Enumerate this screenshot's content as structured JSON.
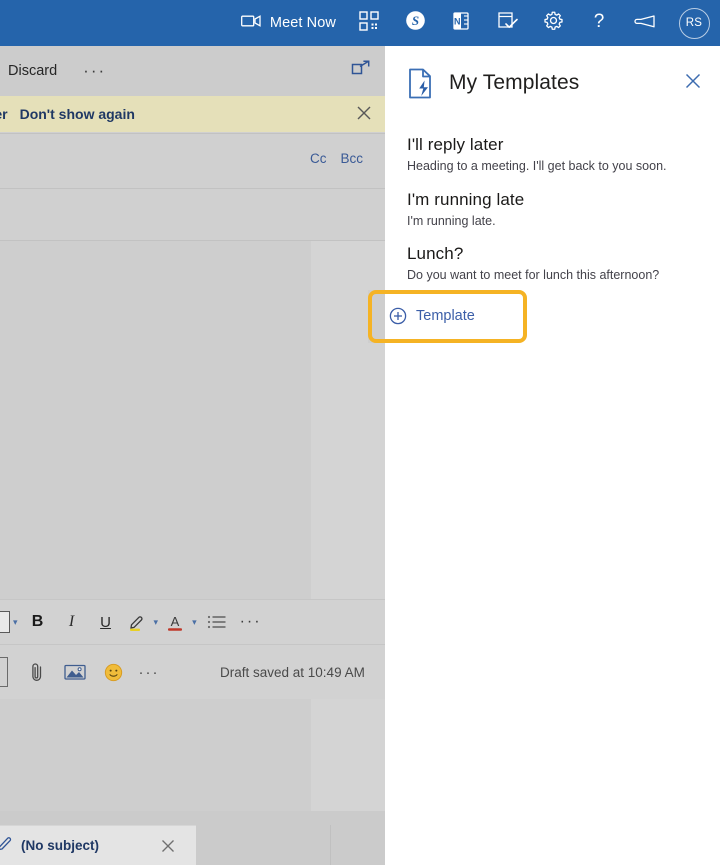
{
  "suitebar": {
    "background": "#2564ab",
    "meet_now_label": "Meet Now",
    "items": [
      {
        "name": "meet-now",
        "label": "Meet Now",
        "icon": "video-camera-icon"
      },
      {
        "name": "qr-code",
        "label": "",
        "icon": "qr-code-icon"
      },
      {
        "name": "skype",
        "label": "",
        "icon": "skype-icon"
      },
      {
        "name": "onenote",
        "label": "",
        "icon": "onenote-icon"
      },
      {
        "name": "to-do",
        "label": "",
        "icon": "checklist-icon"
      },
      {
        "name": "settings",
        "label": "",
        "icon": "gear-icon"
      },
      {
        "name": "help",
        "label": "",
        "icon": "question-mark-icon"
      },
      {
        "name": "feedback",
        "label": "",
        "icon": "megaphone-icon"
      },
      {
        "name": "account",
        "label": "RS",
        "icon": "avatar-icon"
      }
    ],
    "avatar_initials": "RS"
  },
  "compose": {
    "command_bar": {
      "discard_label": "Discard",
      "more_label": "···",
      "popout_icon": "pop-out-icon"
    },
    "notice": {
      "background": "#e5e0b9",
      "link_later": "later",
      "link_dont_show": "Don't show again",
      "close_icon": "close-icon"
    },
    "recipients": {
      "cc_label": "Cc",
      "bcc_label": "Bcc"
    },
    "format_toolbar": {
      "font_label": "",
      "bold_label": "B",
      "italic_label": "I",
      "underline_label": "U",
      "highlight_icon": "highlighter-icon",
      "font_color_icon": "font-color-icon",
      "bullets_icon": "bulleted-list-icon",
      "more_label": "···"
    },
    "attach_toolbar": {
      "attach_icon": "paperclip-icon",
      "image_icon": "picture-icon",
      "emoji_icon": "emoji-icon",
      "more_label": "···",
      "draft_status": "Draft saved at 10:49 AM"
    }
  },
  "tabstrip": {
    "draft_tab": {
      "label": "(No subject)",
      "pencil_icon": "pencil-icon",
      "close_icon": "close-icon"
    }
  },
  "panel": {
    "title": "My Templates",
    "logo_icon": "templates-document-bolt-icon",
    "close_icon": "close-icon",
    "templates": [
      {
        "title": "I'll reply later",
        "body": "Heading to a meeting. I'll get back to you soon."
      },
      {
        "title": "I'm running late",
        "body": "I'm running late."
      },
      {
        "title": "Lunch?",
        "body": "Do you want to meet for lunch this afternoon?"
      }
    ],
    "add_template": {
      "label": "Template",
      "icon": "circle-plus-icon",
      "highlight_color": "#f5b324",
      "highlighted": true
    }
  }
}
